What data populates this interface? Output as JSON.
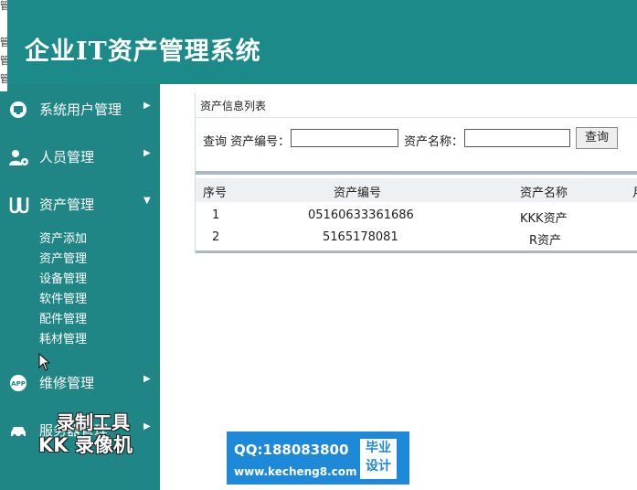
{
  "app": {
    "title": "企业IT资产管理系统"
  },
  "edge_text": [
    "管",
    "管",
    "管",
    "管"
  ],
  "sidebar": {
    "groups": [
      {
        "label": "系统用户管理",
        "icon": "monitor-icon",
        "expanded": false
      },
      {
        "label": "人员管理",
        "icon": "user-gear-icon",
        "expanded": false
      },
      {
        "label": "资产管理",
        "icon": "asset-icon",
        "expanded": true,
        "items": [
          "资产添加",
          "资产管理",
          "设备管理",
          "软件管理",
          "配件管理",
          "耗材管理"
        ]
      },
      {
        "label": "维修管理",
        "icon": "app-icon",
        "expanded": false
      },
      {
        "label": "服务器管理",
        "icon": "car-icon",
        "expanded": false
      }
    ]
  },
  "panel": {
    "title": "资产信息列表",
    "search": {
      "query_label": "查询 资产编号：",
      "asset_id_value": "",
      "name_label": "资产名称：",
      "asset_name_value": "",
      "button": "查询"
    },
    "table": {
      "columns": [
        "序号",
        "资产编号",
        "资产名称",
        "月"
      ],
      "rows": [
        [
          "1",
          "05160633361686",
          "KKK资产"
        ],
        [
          "2",
          "5165178081",
          "R资产"
        ]
      ]
    }
  },
  "watermark": {
    "line1": "录制工具",
    "line2": "KK 录像机",
    "qq": "QQ:188083800",
    "url": "www.kecheng8.com",
    "tag1": "毕业",
    "tag2": "设计"
  },
  "colors": {
    "header": "#1d8a8a",
    "sidebar": "#1f8585",
    "accent": "#1e88d9"
  }
}
